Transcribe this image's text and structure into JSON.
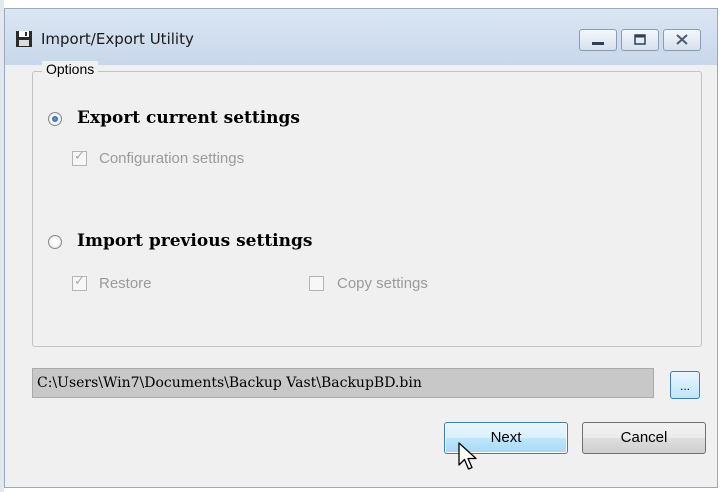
{
  "window": {
    "title": "Import/Export Utility",
    "icon": "floppy-disk-icon",
    "controls": [
      "minimize-icon",
      "maximize-icon",
      "close-icon"
    ]
  },
  "options": {
    "legend": "Options",
    "export": {
      "label": "Export current settings",
      "selected": true,
      "configuration": {
        "label": "Configuration settings",
        "checked": true,
        "enabled": false
      }
    },
    "import": {
      "label": "Import previous settings",
      "selected": false,
      "restore": {
        "label": "Restore",
        "checked": true,
        "enabled": false
      },
      "copy_settings": {
        "label": "Copy settings",
        "checked": false,
        "enabled": false
      }
    }
  },
  "file": {
    "path": "C:\\Users\\Win7\\Documents\\Backup Vast\\BackupBD.bin",
    "browse_label": "..."
  },
  "buttons": {
    "next": "Next",
    "cancel": "Cancel"
  }
}
